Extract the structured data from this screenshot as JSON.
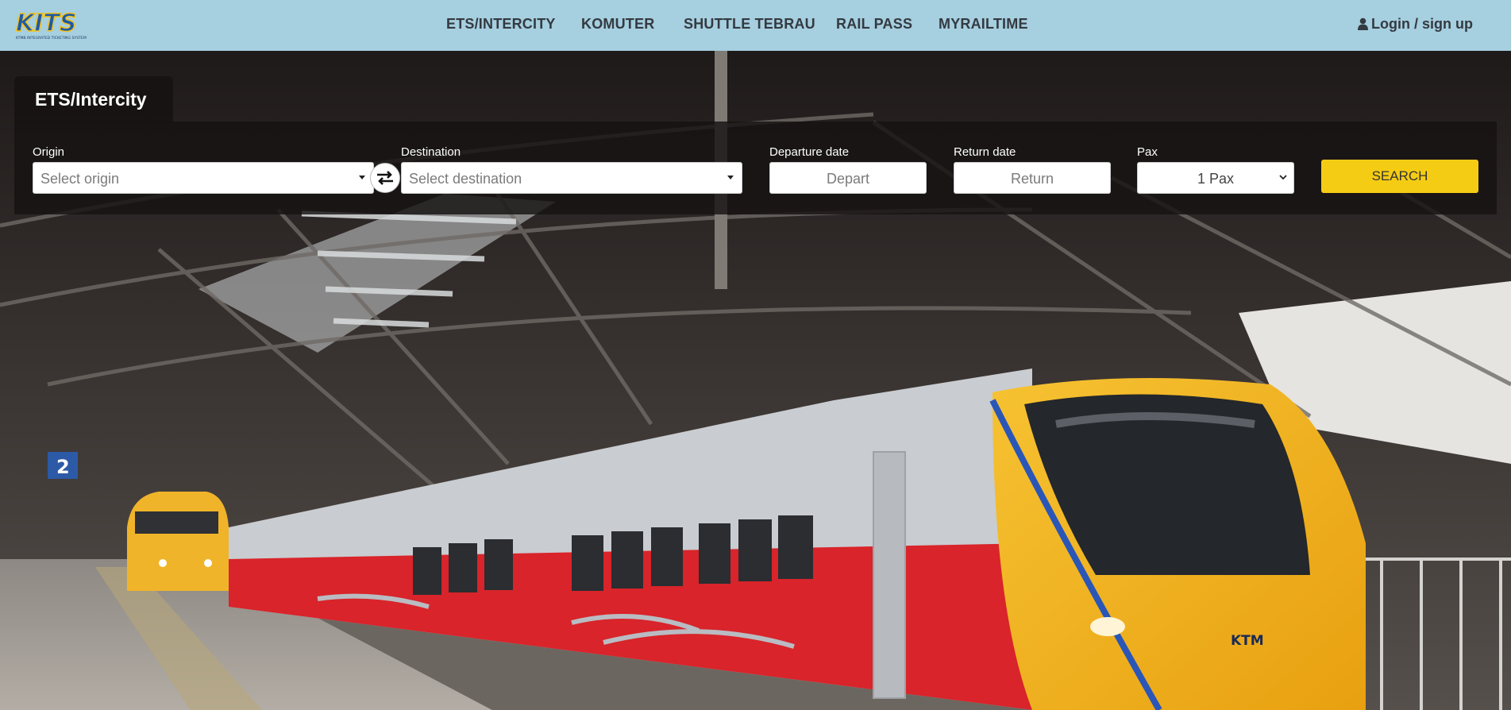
{
  "brand": {
    "logo_text": "KITS",
    "logo_tagline": "KTMB INTEGRATED TICKETING SYSTEM"
  },
  "nav": {
    "items": [
      {
        "label": "ETS/INTERCITY"
      },
      {
        "label": "KOMUTER"
      },
      {
        "label": "SHUTTLE TEBRAU"
      },
      {
        "label": "RAIL PASS"
      },
      {
        "label": "MYRAILTIME"
      }
    ],
    "login_label": "Login / sign up",
    "login_icon": "user-icon"
  },
  "search": {
    "active_tab": "ETS/Intercity",
    "origin": {
      "label": "Origin",
      "placeholder": "Select origin"
    },
    "swap_icon": "swap-arrows-icon",
    "destination": {
      "label": "Destination",
      "placeholder": "Select destination"
    },
    "departure": {
      "label": "Departure date",
      "placeholder": "Depart"
    },
    "return": {
      "label": "Return date",
      "placeholder": "Return"
    },
    "pax": {
      "label": "Pax",
      "value": "1 Pax"
    },
    "button_label": "SEARCH"
  },
  "hero": {
    "platform_number": "2",
    "train_brand": "KTM",
    "colors": {
      "train_yellow": "#f2b21c",
      "train_red": "#d8242a",
      "train_silver": "#c9ccd0",
      "stripe_blue": "#2a56b8"
    }
  },
  "colors": {
    "topbar": "#a6cfe0",
    "accent": "#f5cc14",
    "panel": "#161212"
  }
}
